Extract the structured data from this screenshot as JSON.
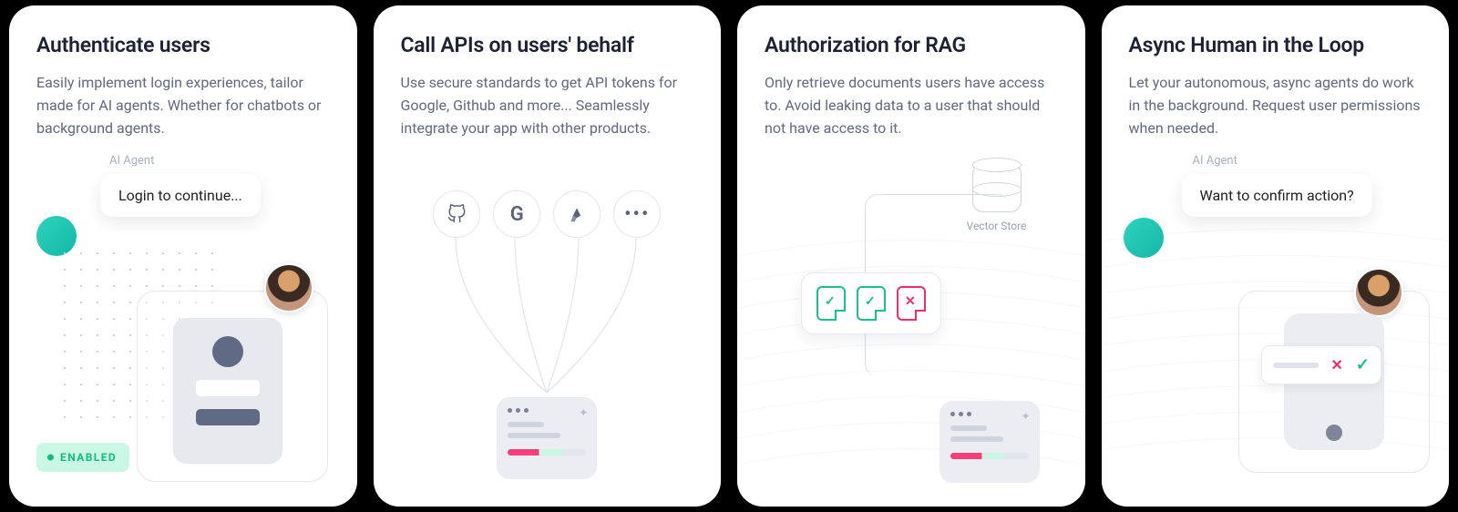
{
  "cards": [
    {
      "title": "Authenticate users",
      "desc": "Easily implement login experiences, tailor made for AI agents. Whether for chatbots or background agents.",
      "agent_label": "AI Agent",
      "bubble": "Login to continue...",
      "badge": "ENABLED"
    },
    {
      "title": "Call APIs on users' behalf",
      "desc": "Use secure standards to get API tokens for Google, Github and more... Seamlessly integrate your app with other products.",
      "icons": [
        "github",
        "google",
        "atlassian",
        "more"
      ]
    },
    {
      "title": "Authorization for RAG",
      "desc": "Only retrieve documents users have access to. Avoid leaking data to a user that should not have access to it.",
      "vector_store_label": "Vector Store",
      "doc_states": [
        "ok",
        "ok",
        "no"
      ]
    },
    {
      "title": "Async Human in the Loop",
      "desc": "Let your autonomous, async agents do work in the background. Request user permissions when needed.",
      "agent_label": "AI Agent",
      "bubble": "Want to confirm action?"
    }
  ]
}
